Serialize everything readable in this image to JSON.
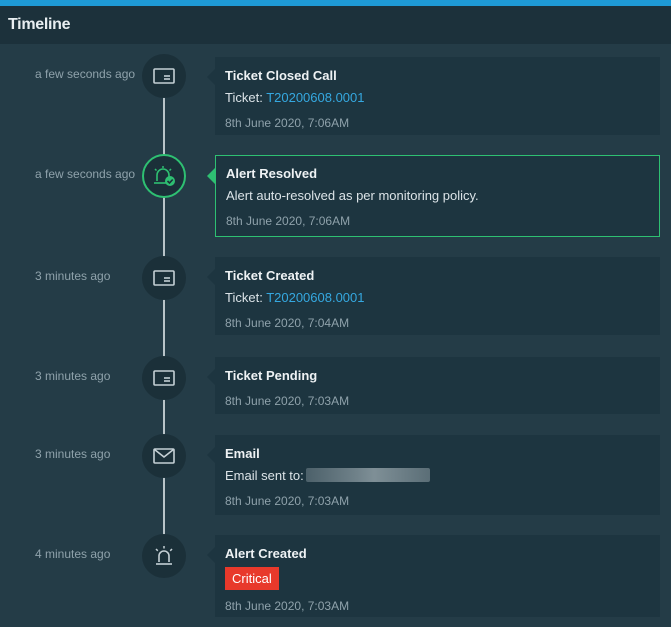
{
  "header": {
    "title": "Timeline"
  },
  "colors": {
    "accent_bar": "#1e9ad6",
    "resolved_green": "#2ec072",
    "critical_red": "#e8392b",
    "link_blue": "#35a8e0"
  },
  "events": [
    {
      "ago": "a few seconds ago",
      "icon": "ticket-icon",
      "title": "Ticket Closed Call",
      "detail_label": "Ticket: ",
      "detail_link": "T20200608.0001",
      "date": "8th June 2020, 7:06AM"
    },
    {
      "ago": "a few seconds ago",
      "icon": "alert-resolved-icon",
      "title": "Alert Resolved",
      "detail_text": "Alert auto-resolved as per monitoring policy.",
      "date": "8th June 2020, 7:06AM"
    },
    {
      "ago": "3 minutes ago",
      "icon": "ticket-icon",
      "title": "Ticket Created",
      "detail_label": "Ticket: ",
      "detail_link": "T20200608.0001",
      "date": "8th June 2020, 7:04AM"
    },
    {
      "ago": "3 minutes ago",
      "icon": "ticket-icon",
      "title": "Ticket Pending",
      "date": "8th June 2020, 7:03AM"
    },
    {
      "ago": "3 minutes ago",
      "icon": "envelope-icon",
      "title": "Email",
      "detail_label": "Email sent to:",
      "date": "8th June 2020, 7:03AM"
    },
    {
      "ago": "4 minutes ago",
      "icon": "alarm-icon",
      "title": "Alert Created",
      "badge": "Critical",
      "date": "8th June 2020, 7:03AM"
    }
  ]
}
